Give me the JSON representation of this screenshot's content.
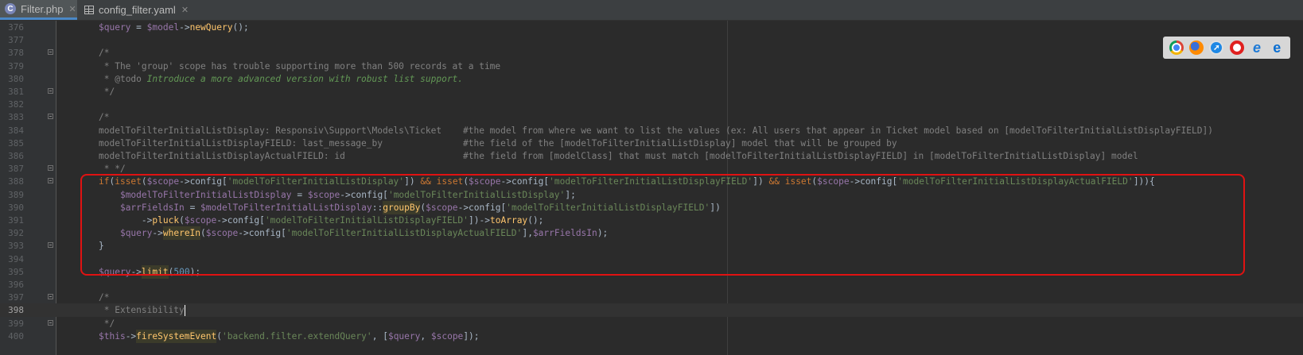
{
  "tabs": [
    {
      "label": "Filter.php",
      "active": true,
      "icon": "php-icon"
    },
    {
      "label": "config_filter.yaml",
      "active": false,
      "icon": "yaml-table-icon"
    }
  ],
  "browser_icons": [
    "chrome-icon",
    "firefox-icon",
    "safari-icon",
    "opera-icon",
    "internet-explorer-icon",
    "edge-icon"
  ],
  "colors": {
    "keyword": "#cc7832",
    "variable": "#9876aa",
    "string": "#6a8759",
    "number": "#6897bb",
    "function": "#ffc66d",
    "comment": "#808080",
    "text": "#a9b7c6",
    "doc_tag": "#629755",
    "highlight_box": "#e01212"
  },
  "editor": {
    "current_line": 398,
    "lines": [
      {
        "n": 376,
        "fold": false,
        "segs": [
          [
            "$query",
            "v"
          ],
          [
            " = ",
            "t"
          ],
          [
            "$model",
            "v"
          ],
          [
            "->",
            "t"
          ],
          [
            "newQuery",
            "f"
          ],
          [
            "();",
            "t"
          ]
        ]
      },
      {
        "n": 377,
        "fold": false,
        "segs": []
      },
      {
        "n": 378,
        "fold": true,
        "segs": [
          [
            "/*",
            "c"
          ]
        ]
      },
      {
        "n": 379,
        "fold": false,
        "segs": [
          [
            " * The 'group' scope has trouble supporting more than 500 records at a time",
            "c"
          ]
        ]
      },
      {
        "n": 380,
        "fold": false,
        "segs": [
          [
            " * ",
            "c"
          ],
          [
            "@todo",
            "c"
          ],
          [
            " Introduce a more advanced version with robust list support.",
            "i"
          ]
        ]
      },
      {
        "n": 381,
        "fold": true,
        "segs": [
          [
            " */",
            "c"
          ]
        ]
      },
      {
        "n": 382,
        "fold": false,
        "segs": []
      },
      {
        "n": 383,
        "fold": true,
        "segs": [
          [
            "/*",
            "c"
          ]
        ]
      },
      {
        "n": 384,
        "fold": false,
        "segs": [
          [
            "modelToFilterInitialListDisplay: Responsiv\\Support\\Models\\Ticket    #the model from where we want to list the values (ex: All users that appear in Ticket model based on [modelToFilterInitialListDisplayFIELD])",
            "c"
          ]
        ]
      },
      {
        "n": 385,
        "fold": false,
        "segs": [
          [
            "modelToFilterInitialListDisplayFIELD: last_message_by               #the field of the [modelToFilterInitialListDisplay] model that will be grouped by",
            "c"
          ]
        ]
      },
      {
        "n": 386,
        "fold": false,
        "segs": [
          [
            "modelToFilterInitialListDisplayActualFIELD: id                      #the field from [modelClass] that must match [modelToFilterInitialListDisplayFIELD] in [modelToFilterInitialListDisplay] model",
            "c"
          ]
        ]
      },
      {
        "n": 387,
        "fold": true,
        "segs": [
          [
            " * */",
            "c"
          ]
        ]
      },
      {
        "n": 388,
        "fold": true,
        "segs": [
          [
            "if",
            "k"
          ],
          [
            "(",
            "t"
          ],
          [
            "isset",
            "k"
          ],
          [
            "(",
            "t"
          ],
          [
            "$scope",
            "v"
          ],
          [
            "->config[",
            "t"
          ],
          [
            "'modelToFilterInitialListDisplay'",
            "s"
          ],
          [
            "]) ",
            "t"
          ],
          [
            "&&",
            "k"
          ],
          [
            " ",
            "t"
          ],
          [
            "isset",
            "k"
          ],
          [
            "(",
            "t"
          ],
          [
            "$scope",
            "v"
          ],
          [
            "->config[",
            "t"
          ],
          [
            "'modelToFilterInitialListDisplayFIELD'",
            "s"
          ],
          [
            "]) ",
            "t"
          ],
          [
            "&&",
            "k"
          ],
          [
            " ",
            "t"
          ],
          [
            "isset",
            "k"
          ],
          [
            "(",
            "t"
          ],
          [
            "$scope",
            "v"
          ],
          [
            "->config[",
            "t"
          ],
          [
            "'modelToFilterInitialListDisplayActualFIELD'",
            "s"
          ],
          [
            "])){",
            "t"
          ]
        ]
      },
      {
        "n": 389,
        "fold": false,
        "segs": [
          [
            "    ",
            "t"
          ],
          [
            "$modelToFilterInitialListDisplay",
            "v"
          ],
          [
            " = ",
            "t"
          ],
          [
            "$scope",
            "v"
          ],
          [
            "->config[",
            "t"
          ],
          [
            "'modelToFilterInitialListDisplay'",
            "s"
          ],
          [
            "];",
            "t"
          ]
        ]
      },
      {
        "n": 390,
        "fold": false,
        "segs": [
          [
            "    ",
            "t"
          ],
          [
            "$arrFieldsIn",
            "v"
          ],
          [
            " = ",
            "t"
          ],
          [
            "$modelToFilterInitialListDisplay",
            "v"
          ],
          [
            "::",
            "t"
          ],
          [
            "groupBy",
            "f"
          ],
          [
            "(",
            "t"
          ],
          [
            "$scope",
            "v"
          ],
          [
            "->config[",
            "t"
          ],
          [
            "'modelToFilterInitialListDisplayFIELD'",
            "s"
          ],
          [
            "])",
            "t"
          ]
        ]
      },
      {
        "n": 391,
        "fold": false,
        "segs": [
          [
            "        ->",
            "t"
          ],
          [
            "pluck",
            "f"
          ],
          [
            "(",
            "t"
          ],
          [
            "$scope",
            "v"
          ],
          [
            "->config[",
            "t"
          ],
          [
            "'modelToFilterInitialListDisplayFIELD'",
            "s"
          ],
          [
            "])->",
            "t"
          ],
          [
            "toArray",
            "f"
          ],
          [
            "();",
            "t"
          ]
        ]
      },
      {
        "n": 392,
        "fold": false,
        "segs": [
          [
            "    ",
            "t"
          ],
          [
            "$query",
            "v"
          ],
          [
            "->",
            "t"
          ],
          [
            "whereIn",
            "f"
          ],
          [
            "(",
            "t"
          ],
          [
            "$scope",
            "v"
          ],
          [
            "->config[",
            "t"
          ],
          [
            "'modelToFilterInitialListDisplayActualFIELD'",
            "s"
          ],
          [
            "],",
            "t"
          ],
          [
            "$arrFieldsIn",
            "v"
          ],
          [
            ");",
            "t"
          ]
        ]
      },
      {
        "n": 393,
        "fold": true,
        "segs": [
          [
            "}",
            "t"
          ]
        ]
      },
      {
        "n": 394,
        "fold": false,
        "segs": []
      },
      {
        "n": 395,
        "fold": false,
        "segs": [
          [
            "$query",
            "v"
          ],
          [
            "->",
            "t"
          ],
          [
            "limit",
            "f"
          ],
          [
            "(",
            "t"
          ],
          [
            "500",
            "n"
          ],
          [
            ");",
            "t"
          ]
        ]
      },
      {
        "n": 396,
        "fold": false,
        "segs": []
      },
      {
        "n": 397,
        "fold": true,
        "segs": [
          [
            "/*",
            "c"
          ]
        ]
      },
      {
        "n": 398,
        "fold": false,
        "segs": [
          [
            " * Extensibility",
            "c"
          ]
        ]
      },
      {
        "n": 399,
        "fold": true,
        "segs": [
          [
            " */",
            "c"
          ]
        ]
      },
      {
        "n": 400,
        "fold": false,
        "segs": [
          [
            "$this",
            "v"
          ],
          [
            "->",
            "t"
          ],
          [
            "fireSystemEvent",
            "f"
          ],
          [
            "(",
            "t"
          ],
          [
            "'backend.filter.extendQuery'",
            "s"
          ],
          [
            ", [",
            "t"
          ],
          [
            "$query",
            "v"
          ],
          [
            ", ",
            "t"
          ],
          [
            "$scope",
            "v"
          ],
          [
            "]);",
            "t"
          ]
        ]
      }
    ]
  }
}
